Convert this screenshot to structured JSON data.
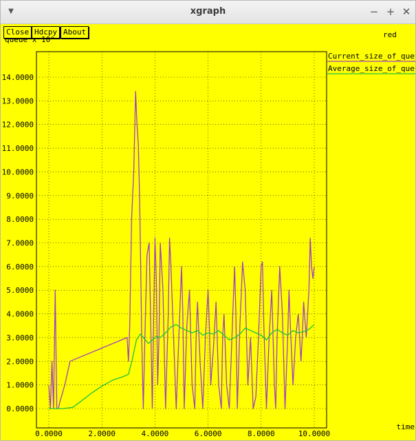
{
  "window": {
    "title": "xgraph"
  },
  "toolbar": {
    "close_label": "Close",
    "hdcpy_label": "Hdcpy",
    "about_label": "About"
  },
  "corner_label": "red",
  "chart_data": {
    "type": "line",
    "title": "",
    "ylabel": "queue x 10°",
    "xlabel": "time",
    "xlim": [
      0,
      10.0
    ],
    "ylim": [
      0,
      14.0
    ],
    "xticks": [
      "0.0000",
      "2.0000",
      "4.0000",
      "6.0000",
      "8.0000",
      "10.0000"
    ],
    "xtick_values": [
      0,
      2,
      4,
      6,
      8,
      10
    ],
    "yticks": [
      "0.0000",
      "1.0000",
      "2.0000",
      "3.0000",
      "4.0000",
      "5.0000",
      "6.0000",
      "7.0000",
      "8.0000",
      "9.0000",
      "10.0000",
      "11.0000",
      "12.0000",
      "13.0000",
      "14.0000"
    ],
    "ytick_values": [
      0,
      1,
      2,
      3,
      4,
      5,
      6,
      7,
      8,
      9,
      10,
      11,
      12,
      13,
      14
    ],
    "grid": true,
    "legend_position": "right",
    "series": [
      {
        "name": "Current_size_of_queue",
        "color": "#a040c0",
        "x": [
          0.0,
          0.06,
          0.12,
          0.18,
          0.24,
          0.3,
          0.36,
          0.42,
          0.5,
          0.6,
          0.8,
          2.95,
          3.0,
          3.05,
          3.12,
          3.2,
          3.27,
          3.32,
          3.37,
          3.42,
          3.46,
          3.5,
          3.56,
          3.62,
          3.7,
          3.78,
          3.85,
          3.9,
          3.95,
          4.0,
          4.05,
          4.1,
          4.15,
          4.2,
          4.3,
          4.4,
          4.5,
          4.55,
          4.6,
          4.7,
          4.8,
          4.9,
          5.0,
          5.05,
          5.1,
          5.2,
          5.3,
          5.4,
          5.5,
          5.55,
          5.6,
          5.7,
          5.8,
          5.9,
          6.0,
          6.05,
          6.1,
          6.2,
          6.3,
          6.4,
          6.5,
          6.55,
          6.6,
          6.7,
          6.8,
          6.9,
          7.0,
          7.05,
          7.1,
          7.2,
          7.3,
          7.4,
          7.5,
          7.55,
          7.6,
          7.7,
          7.8,
          7.9,
          8.0,
          8.05,
          8.1,
          8.2,
          8.3,
          8.4,
          8.5,
          8.55,
          8.6,
          8.7,
          8.8,
          8.9,
          9.0,
          9.05,
          9.1,
          9.2,
          9.3,
          9.4,
          9.5,
          9.55,
          9.6,
          9.7,
          9.8,
          9.85,
          9.9,
          9.95,
          10.0
        ],
        "values": [
          1.0,
          0.0,
          2.0,
          0.0,
          5.0,
          0.0,
          0.0,
          0.3,
          0.6,
          1.0,
          2.0,
          3.0,
          2.0,
          3.5,
          8.0,
          10.0,
          13.4,
          12.0,
          11.2,
          9.0,
          6.0,
          3.0,
          0.0,
          3.0,
          6.5,
          7.0,
          3.0,
          0.0,
          4.0,
          7.2,
          5.5,
          1.0,
          3.0,
          7.0,
          5.0,
          0.0,
          4.0,
          7.2,
          6.0,
          3.0,
          0.0,
          3.0,
          6.0,
          4.0,
          0.0,
          3.5,
          5.0,
          1.0,
          0.0,
          3.0,
          4.5,
          2.0,
          0.0,
          3.0,
          5.0,
          3.5,
          1.0,
          2.5,
          4.5,
          1.0,
          0.0,
          3.0,
          4.0,
          1.0,
          0.0,
          3.0,
          6.0,
          4.0,
          0.0,
          3.5,
          6.2,
          5.0,
          1.0,
          2.0,
          3.0,
          0.0,
          0.5,
          3.0,
          6.0,
          6.2,
          3.5,
          0.0,
          3.0,
          5.0,
          1.0,
          0.0,
          3.0,
          6.0,
          4.0,
          0.0,
          3.0,
          5.0,
          3.5,
          1.0,
          3.0,
          4.0,
          2.0,
          3.0,
          4.5,
          3.0,
          5.0,
          7.2,
          6.0,
          5.5,
          6.0
        ]
      },
      {
        "name": "Average_size_of_queue",
        "color": "#20c040",
        "x": [
          0.0,
          0.5,
          0.9,
          1.2,
          1.6,
          2.0,
          2.4,
          2.8,
          3.0,
          3.15,
          3.3,
          3.45,
          3.6,
          3.75,
          3.9,
          4.05,
          4.2,
          4.4,
          4.6,
          4.8,
          5.0,
          5.2,
          5.4,
          5.6,
          5.8,
          6.0,
          6.2,
          6.4,
          6.6,
          6.8,
          7.0,
          7.2,
          7.4,
          7.6,
          7.8,
          8.0,
          8.2,
          8.4,
          8.6,
          8.8,
          9.0,
          9.2,
          9.4,
          9.6,
          9.8,
          10.0
        ],
        "values": [
          0.0,
          0.0,
          0.05,
          0.3,
          0.65,
          0.95,
          1.2,
          1.35,
          1.45,
          2.1,
          2.9,
          3.15,
          2.95,
          2.75,
          2.9,
          3.05,
          3.0,
          3.2,
          3.45,
          3.55,
          3.4,
          3.3,
          3.2,
          3.3,
          3.1,
          3.2,
          3.15,
          3.3,
          3.1,
          2.9,
          3.0,
          3.15,
          3.4,
          3.3,
          3.2,
          3.1,
          2.9,
          3.2,
          3.35,
          3.2,
          3.1,
          3.3,
          3.2,
          3.25,
          3.35,
          3.55
        ]
      }
    ]
  }
}
